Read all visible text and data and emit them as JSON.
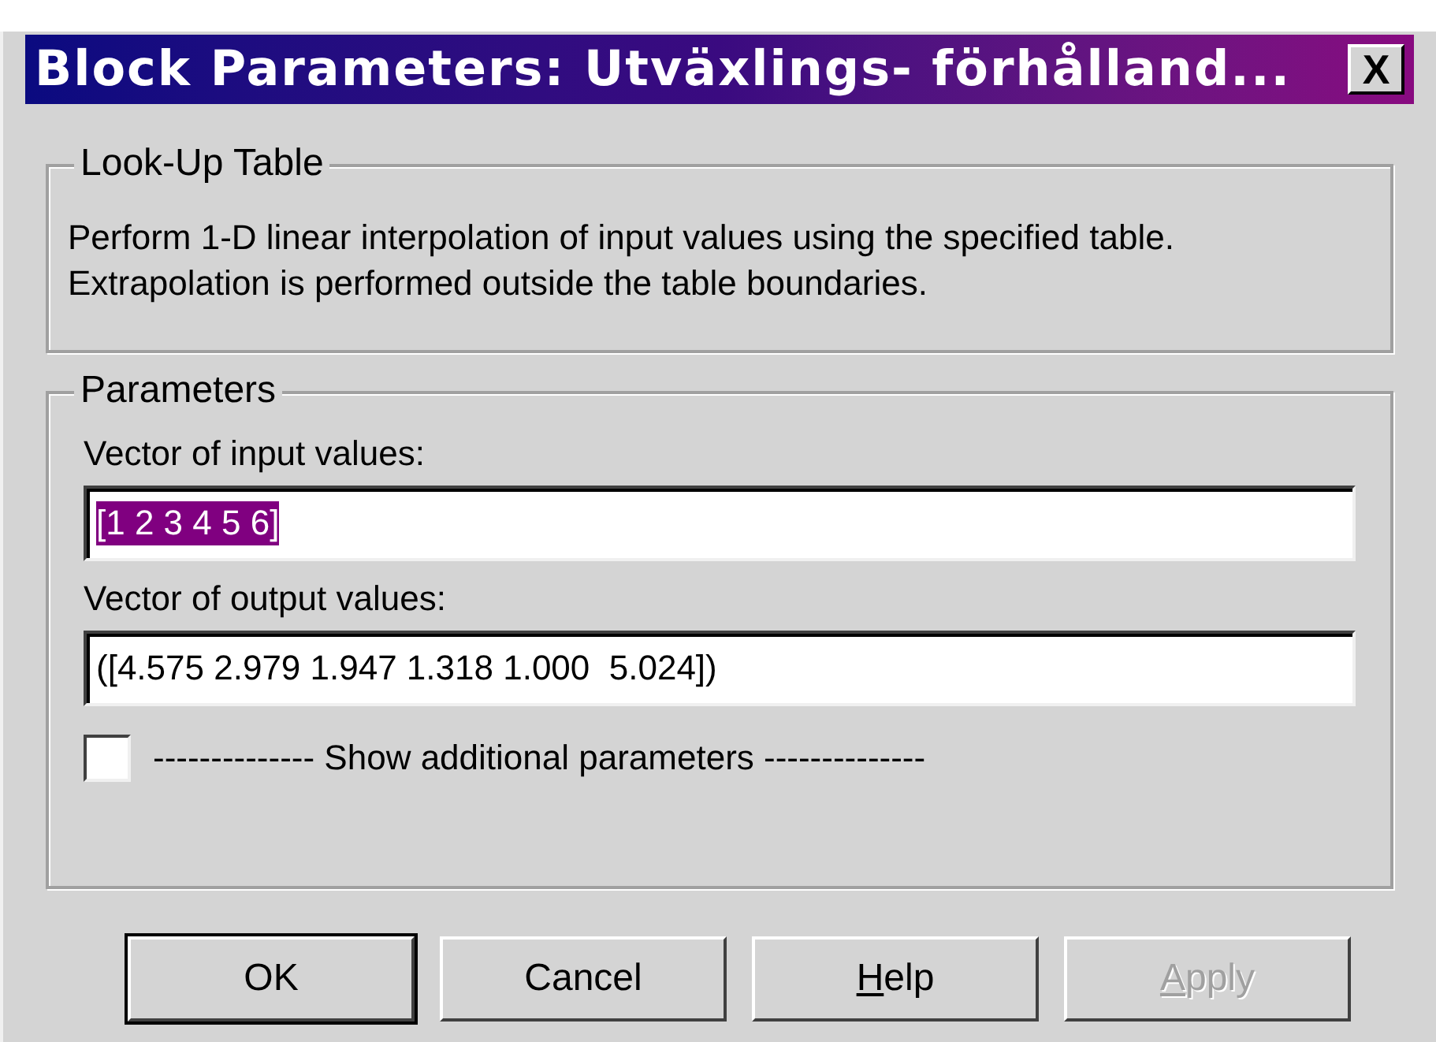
{
  "window": {
    "title": "Block Parameters: Utväxlings- förhålland...",
    "close_label": "X"
  },
  "description_group": {
    "title": "Look-Up Table",
    "text": "Perform 1-D linear interpolation of input values using the specified table. Extrapolation is performed outside the table boundaries."
  },
  "parameters_group": {
    "title": "Parameters",
    "fields": [
      {
        "label": "Vector of input values:",
        "value": "[1 2 3 4 5 6]",
        "selected": true
      },
      {
        "label": "Vector of output values:",
        "value": "([4.575 2.979 1.947 1.318 1.000  5.024])",
        "selected": false
      }
    ],
    "checkbox": {
      "label": "-------------- Show additional parameters --------------",
      "checked": false
    }
  },
  "buttons": [
    {
      "rest": "OK",
      "default": true,
      "disabled": false
    },
    {
      "rest": "Cancel",
      "default": false,
      "disabled": false
    },
    {
      "mnemonic": "H",
      "rest": "elp",
      "default": false,
      "disabled": false
    },
    {
      "mnemonic": "A",
      "rest": "pply",
      "default": false,
      "disabled": true
    }
  ]
}
